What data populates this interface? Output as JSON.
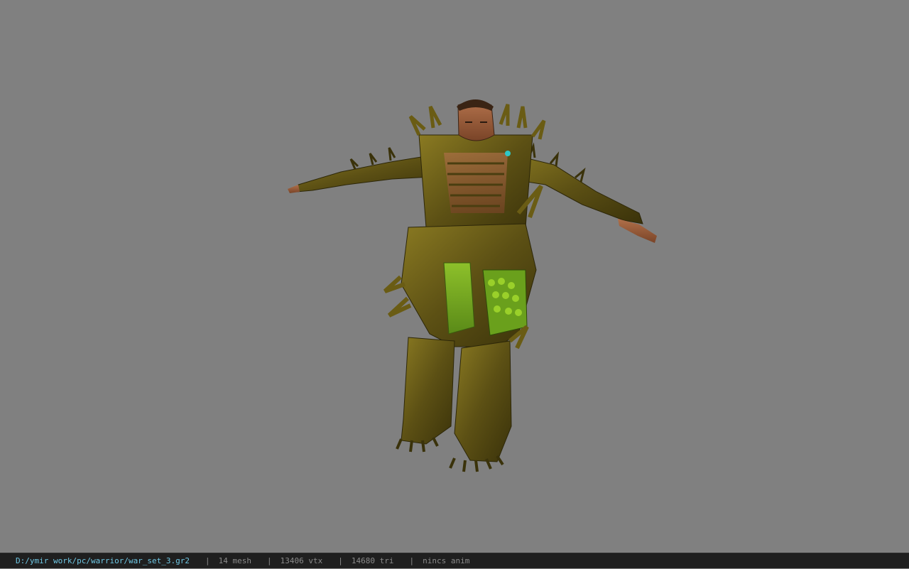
{
  "viewport": {
    "background": "#808080",
    "model_name": "warrior war_set_3"
  },
  "status_bar": {
    "file_path": "D:/ymir work/pc/warrior/war_set_3.gr2",
    "separator": "|",
    "mesh_count": "14 mesh",
    "vertex_count": "13406 vtx",
    "triangle_count": "14680 tri",
    "anim_status": "nincs anim",
    "path_color": "#6fc7e4",
    "text_color": "#8a8a8a"
  }
}
